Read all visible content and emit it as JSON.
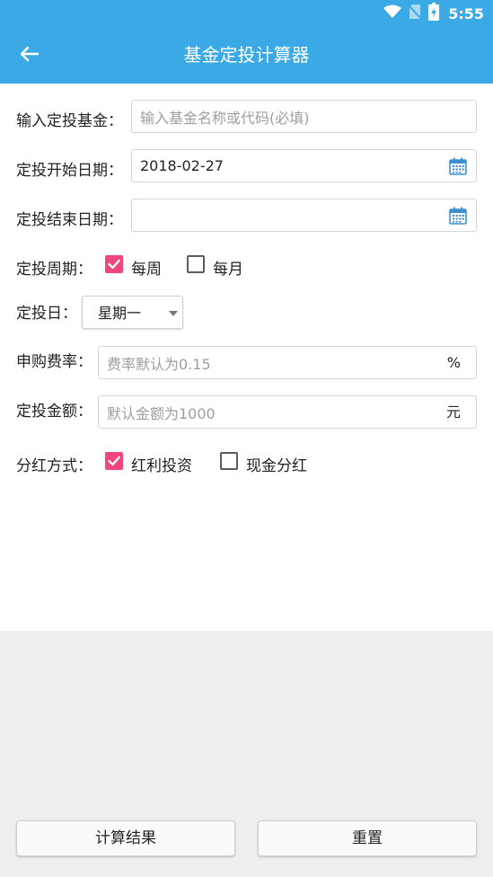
{
  "status_bar": {
    "time": "5:55",
    "icons": [
      "wifi-icon",
      "no-sim-icon",
      "battery-icon"
    ]
  },
  "app_bar": {
    "title": "基金定投计算器",
    "back_icon": "arrow-left-icon"
  },
  "form": {
    "fund": {
      "label": "输入定投基金：",
      "placeholder": "输入基金名称或代码(必填)",
      "value": ""
    },
    "start_date": {
      "label": "定投开始日期：",
      "value": "2018-02-27",
      "icon": "calendar-icon"
    },
    "end_date": {
      "label": "定投结束日期：",
      "value": "",
      "icon": "calendar-icon"
    },
    "period": {
      "label": "定投周期：",
      "options": [
        {
          "label": "每周",
          "checked": true
        },
        {
          "label": "每月",
          "checked": false
        }
      ]
    },
    "day": {
      "label": "定投日：",
      "selected": "星期一"
    },
    "fee_rate": {
      "label": "申购费率：",
      "placeholder": "费率默认为0.15",
      "unit": "%"
    },
    "amount": {
      "label": "定投金额：",
      "placeholder": "默认金额为1000",
      "unit": "元"
    },
    "dividend": {
      "label": "分红方式：",
      "options": [
        {
          "label": "红利投资",
          "checked": true
        },
        {
          "label": "现金分红",
          "checked": false
        }
      ]
    }
  },
  "actions": {
    "calculate_label": "计算结果",
    "reset_label": "重置"
  },
  "colors": {
    "primary": "#3aa9e5",
    "checkbox_checked": "#f0457e",
    "calendar_icon": "#3a8fd6",
    "bottom_background": "#eeeeee"
  }
}
